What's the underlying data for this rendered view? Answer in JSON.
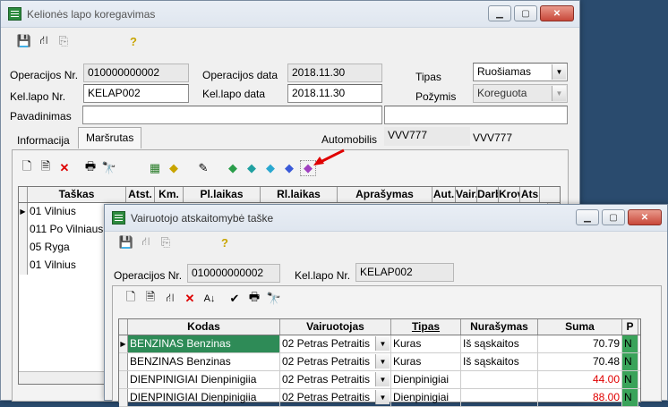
{
  "back_window": {
    "title": "Kelionės lapo koregavimas",
    "labels": {
      "op_nr": "Operacijos Nr.",
      "op_date": "Operacijos data",
      "type": "Tipas",
      "kel_nr": "Kel.lapo Nr.",
      "kel_date": "Kel.lapo data",
      "attr": "Požymis",
      "name": "Pavadinimas",
      "auto": "Automobilis"
    },
    "values": {
      "op_nr": "010000000002",
      "op_date": "2018.11.30",
      "type": "Ruošiamas",
      "kel_nr": "KELAP002",
      "kel_date": "2018.11.30",
      "attr": "Koreguota",
      "name": "",
      "auto_code": "VVV777",
      "auto_text": "VVV777"
    },
    "tabs": [
      "Informacija",
      "Maršrutas"
    ],
    "columns": [
      "Taškas",
      "Atst.",
      "Km.",
      "Pl.laikas",
      "Rl.laikas",
      "Aprašymas",
      "Aut.",
      "Vair.",
      "Darb",
      "Krov",
      "Ats"
    ],
    "rows": [
      "01 Vilnius",
      "011 Po Vilniaus",
      "05 Ryga",
      "01 Vilnius"
    ]
  },
  "front_window": {
    "title": "Vairuotojo atskaitomybė taške",
    "labels": {
      "op_nr": "Operacijos Nr.",
      "kel_nr": "Kel.lapo Nr."
    },
    "values": {
      "op_nr": "010000000002",
      "kel_nr": "KELAP002"
    },
    "columns": [
      "Kodas",
      "Vairuotojas",
      "Tipas",
      "Nurašymas",
      "Suma",
      "P"
    ],
    "rows": [
      {
        "kodas": "BENZINAS  Benzinas",
        "vair": "02 Petras Petraitis",
        "tipas": "Kuras",
        "nur": "Iš sąskaitos",
        "suma": "70.79",
        "p": "N"
      },
      {
        "kodas": "BENZINAS  Benzinas",
        "vair": "02 Petras Petraitis",
        "tipas": "Kuras",
        "nur": "Iš sąskaitos",
        "suma": "70.48",
        "p": "N"
      },
      {
        "kodas": "DIENPINIGIAI  Dienpinigiia",
        "vair": "02 Petras Petraitis",
        "tipas": "Dienpinigiai",
        "nur": "",
        "suma": "44.00",
        "p": "N"
      },
      {
        "kodas": "DIENPINIGIAI  Dienpinigiia",
        "vair": "02 Petras Petraitis",
        "tipas": "Dienpinigiai",
        "nur": "",
        "suma": "88.00",
        "p": "N"
      }
    ]
  },
  "colors": {
    "selected_row": "#2e8b57",
    "negative_amount": "#e00000",
    "p_flag": "#3aa35a",
    "arrow": "#e00000"
  }
}
